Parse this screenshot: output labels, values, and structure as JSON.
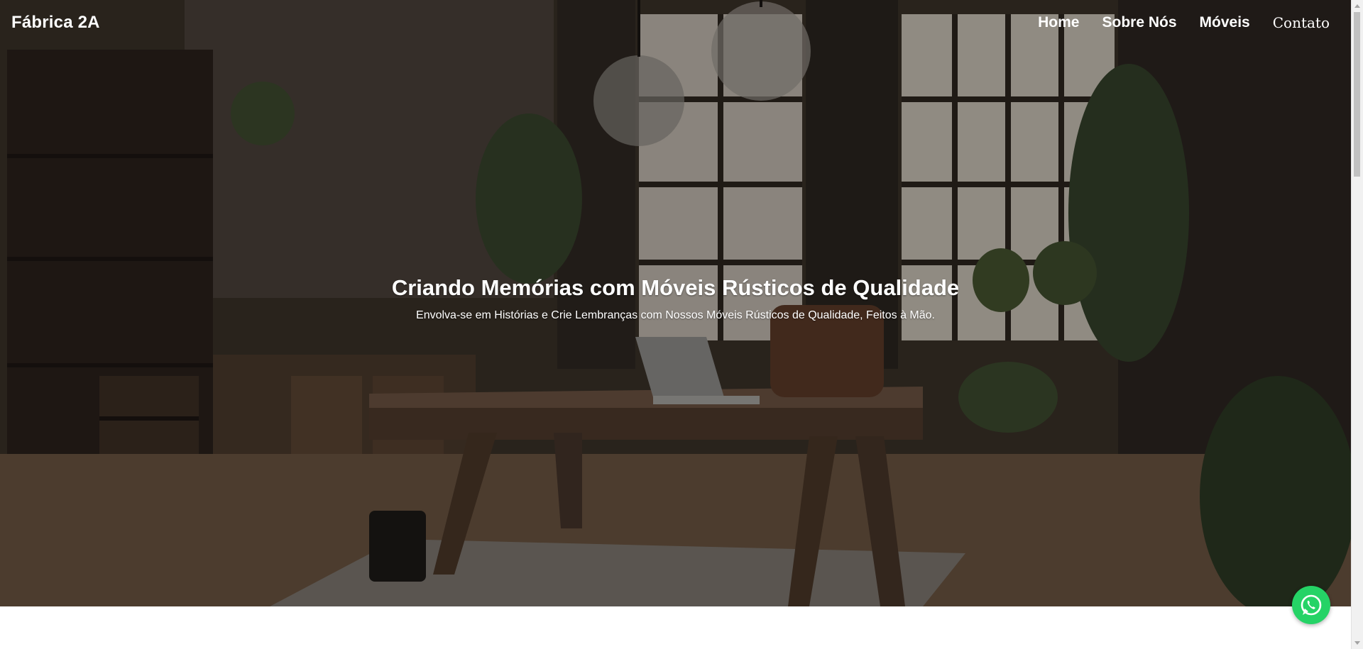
{
  "navbar": {
    "logo": "Fábrica 2A",
    "links": [
      "Home",
      "Sobre Nós",
      "Móveis",
      "Contato"
    ]
  },
  "hero": {
    "title": "Criando Memórias com Móveis Rústicos de Qualidade",
    "subtitle": "Envolva-se em Histórias e Crie Lembranças com Nossos Móveis Rústicos de Qualidade, Feitos à Mão.",
    "background_image": "rustic-office-interior-photo"
  },
  "floating_button": {
    "icon": "whatsapp-icon",
    "color": "#25d366"
  },
  "colors": {
    "nav_text": "#ffffff",
    "hero_text": "#ffffff"
  }
}
